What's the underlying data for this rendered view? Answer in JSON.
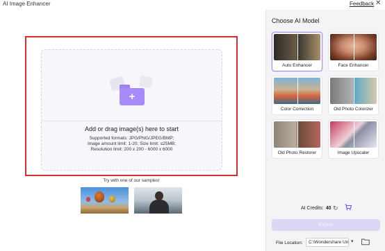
{
  "window": {
    "title": "AI Image Enhancer",
    "feedback_label": "Feedback",
    "close_glyph": "✕"
  },
  "dropzone": {
    "title": "Add or drag image(s) here to start",
    "formats": "Supported formats: JPG/PNG/JPEG/BMP;",
    "limits": "Image amount limit: 1-20; Size limit: ≤25MB;",
    "resolution": "Resolution limit: 200 x 200 - 6000 x 6000",
    "icon": "add-folder-icon",
    "highlight_color": "#d32f2f"
  },
  "samples": {
    "title": "Try with one of our samples!",
    "items": [
      "hot-air-balloons-sample",
      "person-portrait-sample"
    ]
  },
  "panel": {
    "title": "Choose AI Model",
    "models": [
      {
        "label": "Auto Enhancer",
        "selected": true
      },
      {
        "label": "Face Enhancer",
        "selected": false
      },
      {
        "label": "Color Correction",
        "selected": false
      },
      {
        "label": "Old Photo Colorizer",
        "selected": false
      },
      {
        "label": "Old Photo Restorer",
        "selected": false
      },
      {
        "label": "Image Upscaler",
        "selected": false
      }
    ],
    "credits_label": "AI Credits:",
    "credits_value": "40",
    "refresh_glyph": "↻",
    "export_label": "Export",
    "file_location_label": "File Location:",
    "file_location_value": "C:\\Wondershare UniCon",
    "dropdown_glyph": "▾"
  },
  "colors": {
    "accent": "#a78bfa",
    "export_disabled": "#ddd6f7",
    "panel_bg": "#f4f4f6"
  }
}
